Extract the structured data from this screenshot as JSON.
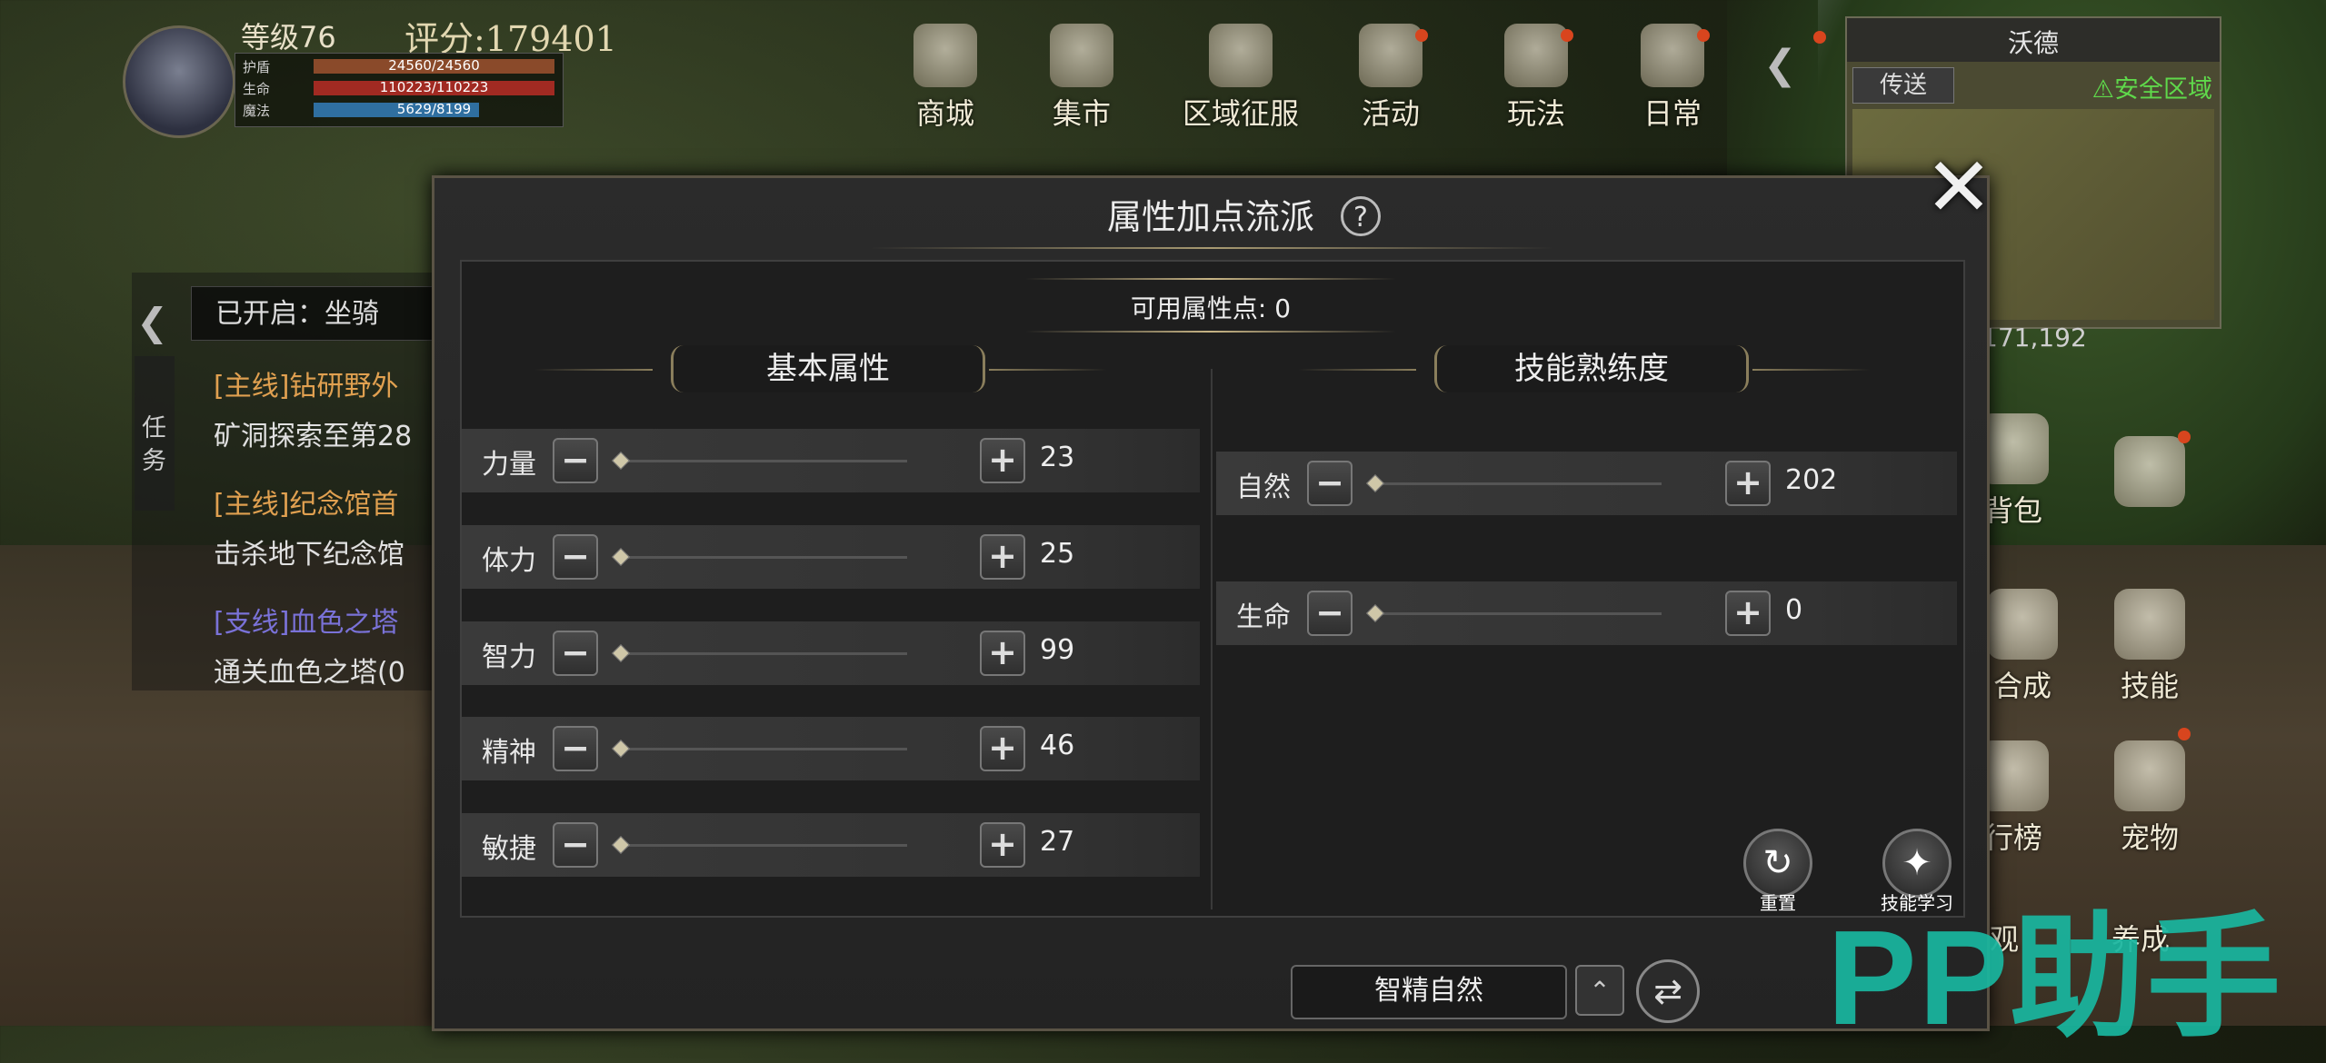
{
  "player": {
    "level_text": "等级76",
    "score_text": "评分:179401",
    "stats": [
      {
        "label": "护盾",
        "value": "24560/24560",
        "color": "#8a4a2a",
        "fill": 1.0
      },
      {
        "label": "生命",
        "value": "110223/110223",
        "color": "#a12a22",
        "fill": 1.0
      },
      {
        "label": "魔法",
        "value": "5629/8199",
        "color": "#2f6fa0",
        "fill": 0.687
      }
    ]
  },
  "top_menu": [
    {
      "label": "商城",
      "icon": "shop-icon"
    },
    {
      "label": "集市",
      "icon": "market-icon"
    },
    {
      "label": "区域征服",
      "icon": "conquest-icon"
    },
    {
      "label": "活动",
      "icon": "event-icon"
    },
    {
      "label": "玩法",
      "icon": "gameplay-icon"
    },
    {
      "label": "日常",
      "icon": "daily-icon"
    }
  ],
  "minimap": {
    "title": "沃德",
    "teleport": "传送",
    "safe_zone": "安全区域",
    "coords": "171,192"
  },
  "quest_panel": {
    "unlocked": "已开启：坐骑",
    "tab_label": "任务",
    "lines": [
      {
        "text": "[主线]钻研野外",
        "color": "#e0a050"
      },
      {
        "text": "矿洞探索至第28",
        "color": "#e0e0e0"
      },
      {
        "text": "[主线]纪念馆首",
        "color": "#e0a050"
      },
      {
        "text": "击杀地下纪念馆",
        "color": "#e0e0e0"
      },
      {
        "text": "[支线]血色之塔",
        "color": "#7a72d8"
      },
      {
        "text": "通关血色之塔(0",
        "color": "#e0e0e0"
      }
    ]
  },
  "right_menu": [
    {
      "label": "背包",
      "icon": "bag-icon"
    },
    {
      "label": "",
      "icon": "compass-icon"
    },
    {
      "label": "合成",
      "icon": "craft-icon"
    },
    {
      "label": "技能",
      "icon": "skill-icon"
    },
    {
      "label": "行榜",
      "icon": "ranking-icon"
    },
    {
      "label": "宠物",
      "icon": "pet-icon"
    },
    {
      "label": "观",
      "icon": "view-icon"
    },
    {
      "label": "养成",
      "icon": "growth-icon"
    }
  ],
  "dialog": {
    "title": "属性加点流派",
    "available_points": "可用属性点: 0",
    "basic_title": "基本属性",
    "skill_title": "技能熟练度",
    "basic_attributes": [
      {
        "label": "力量",
        "value": "23"
      },
      {
        "label": "体力",
        "value": "25"
      },
      {
        "label": "智力",
        "value": "99"
      },
      {
        "label": "精神",
        "value": "46"
      },
      {
        "label": "敏捷",
        "value": "27"
      }
    ],
    "skill_attributes": [
      {
        "label": "自然",
        "value": "202"
      },
      {
        "label": "生命",
        "value": "0"
      }
    ],
    "minus_symbol": "−",
    "plus_symbol": "+",
    "reset_label": "重置",
    "skill_learn_label": "技能学习",
    "scheme_name": "智精自然"
  },
  "watermark": "PP助手",
  "colors": {
    "accent": "#8a7e5c",
    "safe": "#5fd94b",
    "watermark": "#19b7a0"
  }
}
